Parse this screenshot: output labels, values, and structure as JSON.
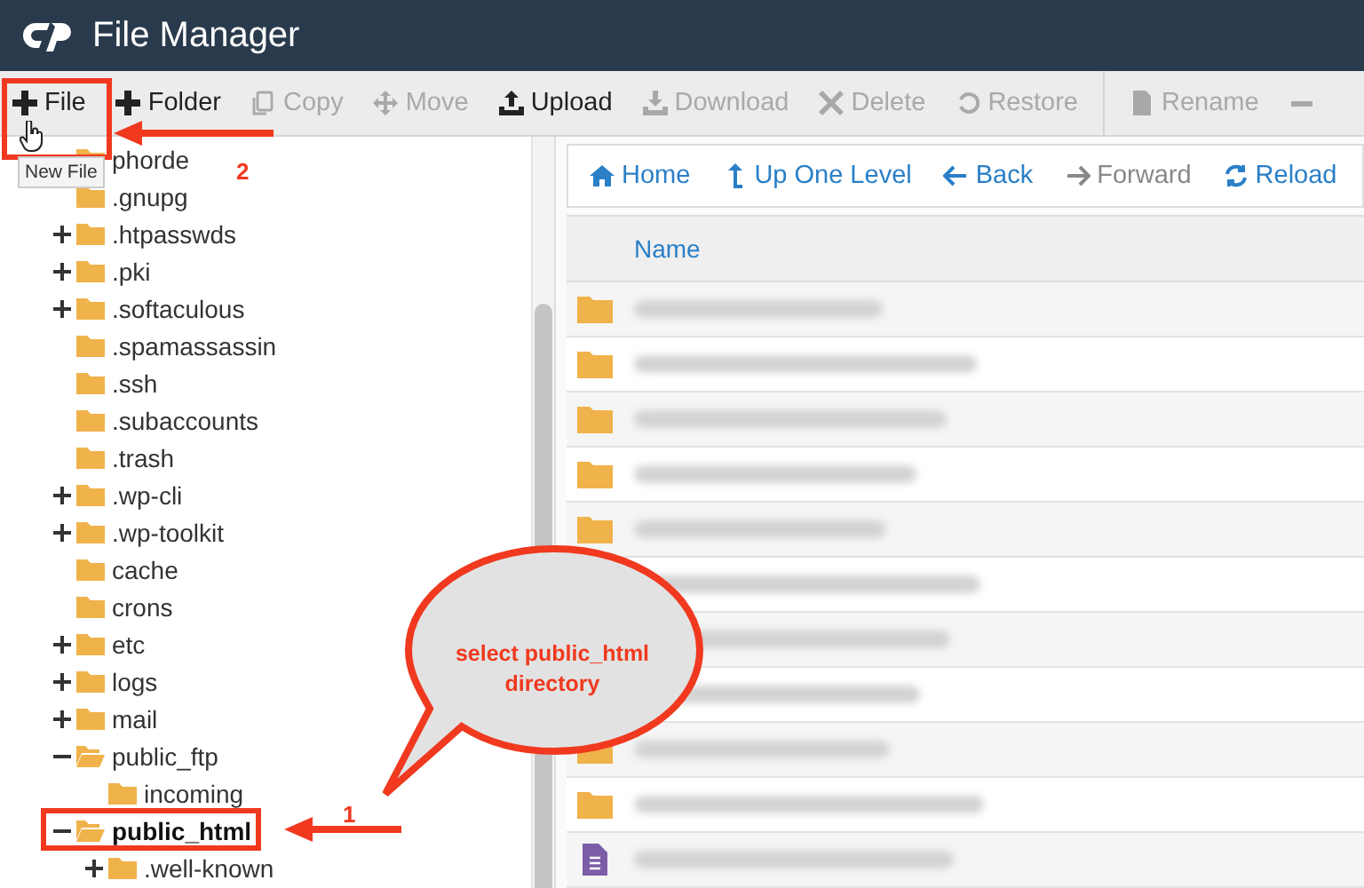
{
  "window": {
    "title": "File Manager"
  },
  "toolbar": {
    "groups": [
      [
        {
          "label": "File",
          "kind": "plus",
          "enabled": true
        },
        {
          "label": "Folder",
          "kind": "plus",
          "enabled": true
        },
        {
          "label": "Copy",
          "kind": "copy",
          "enabled": false
        },
        {
          "label": "Move",
          "kind": "move",
          "enabled": false
        },
        {
          "label": "Upload",
          "kind": "upload",
          "enabled": true
        },
        {
          "label": "Download",
          "kind": "download",
          "enabled": false
        },
        {
          "label": "Delete",
          "kind": "delete",
          "enabled": false
        },
        {
          "label": "Restore",
          "kind": "restore",
          "enabled": false
        }
      ],
      [
        {
          "label": "Rename",
          "kind": "rename",
          "enabled": false
        },
        {
          "kind": "more",
          "enabled": false
        }
      ]
    ]
  },
  "tree": [
    {
      "label": "phorde",
      "collapsible": false,
      "selected": false
    },
    {
      "label": ".gnupg",
      "collapsible": false,
      "selected": false
    },
    {
      "label": ".htpasswds",
      "collapsible": true,
      "expanded": false,
      "selected": false
    },
    {
      "label": ".pki",
      "collapsible": true,
      "expanded": false,
      "selected": false
    },
    {
      "label": ".softaculous",
      "collapsible": true,
      "expanded": false,
      "selected": false
    },
    {
      "label": ".spamassassin",
      "collapsible": false,
      "selected": false
    },
    {
      "label": ".ssh",
      "collapsible": false,
      "selected": false
    },
    {
      "label": ".subaccounts",
      "collapsible": false,
      "selected": false
    },
    {
      "label": ".trash",
      "collapsible": false,
      "selected": false
    },
    {
      "label": ".wp-cli",
      "collapsible": true,
      "expanded": false,
      "selected": false
    },
    {
      "label": ".wp-toolkit",
      "collapsible": true,
      "expanded": false,
      "selected": false
    },
    {
      "label": "cache",
      "collapsible": false,
      "selected": false
    },
    {
      "label": "crons",
      "collapsible": false,
      "selected": false
    },
    {
      "label": "etc",
      "collapsible": true,
      "expanded": false,
      "selected": false
    },
    {
      "label": "logs",
      "collapsible": true,
      "expanded": false,
      "selected": false
    },
    {
      "label": "mail",
      "collapsible": true,
      "expanded": false,
      "selected": false
    },
    {
      "label": "public_ftp",
      "collapsible": true,
      "expanded": true,
      "selected": false,
      "children": [
        {
          "label": "incoming",
          "collapsible": false,
          "selected": false
        }
      ]
    },
    {
      "label": "public_html",
      "collapsible": true,
      "expanded": true,
      "selected": true,
      "children": [
        {
          "label": ".well-known",
          "collapsible": true,
          "expanded": false,
          "selected": false
        }
      ]
    }
  ],
  "nav": [
    {
      "label": "Home",
      "kind": "home",
      "enabled": true
    },
    {
      "label": "Up One Level",
      "kind": "up",
      "enabled": true
    },
    {
      "label": "Back",
      "kind": "back",
      "enabled": true
    },
    {
      "label": "Forward",
      "kind": "forward",
      "enabled": false
    },
    {
      "label": "Reload",
      "kind": "reload",
      "enabled": true
    }
  ],
  "table": {
    "columns": [
      "Name"
    ],
    "rows": [
      {
        "kind": "folder"
      },
      {
        "kind": "folder"
      },
      {
        "kind": "folder"
      },
      {
        "kind": "folder"
      },
      {
        "kind": "folder"
      },
      {
        "kind": "covered"
      },
      {
        "kind": "covered"
      },
      {
        "kind": "covered"
      },
      {
        "kind": "folder"
      },
      {
        "kind": "folder"
      },
      {
        "kind": "file"
      }
    ]
  },
  "annotations": {
    "tooltip": "New File",
    "balloon": "select public_html directory",
    "steps": [
      "2",
      "1"
    ]
  }
}
